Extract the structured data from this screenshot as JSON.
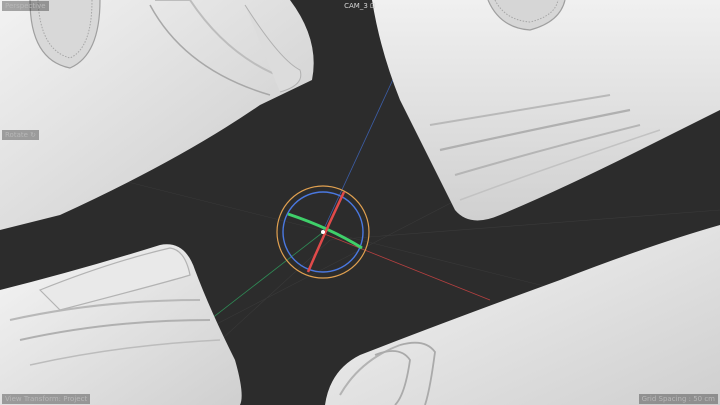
{
  "viewport": {
    "view_mode": "Perspective",
    "camera": "CAM_3 ",
    "tool": "Rotate ",
    "view_transform": "View Transform: Project",
    "grid_spacing": "Grid Spacing : 50 cm"
  },
  "colors": {
    "background": "#2c2c2c",
    "model": "#e6e6e6",
    "axis_x": "#e04a4a",
    "axis_y": "#3fd06a",
    "axis_z": "#4a78e0",
    "gizmo_ring_outer": "#e0a050",
    "gizmo_ring_inner": "#4a78e0"
  },
  "icons": [
    "camera-lock-icon",
    "rotate-tool-icon"
  ]
}
